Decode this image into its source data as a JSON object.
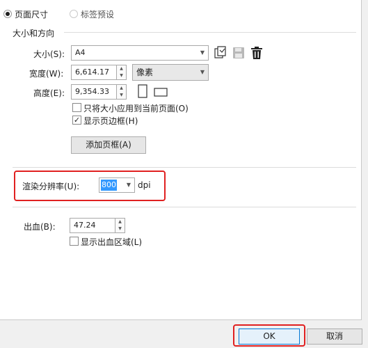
{
  "tabs": {
    "page_size": "页面尺寸",
    "label_preset": "标签预设"
  },
  "section_size": {
    "title": "大小和方向",
    "size_label": "大小(S):",
    "size_value": "A4",
    "width_label": "宽度(W):",
    "width_value": "6,614.17",
    "unit_value": "像素",
    "height_label": "高度(E):",
    "height_value": "9,354.33",
    "apply_current_label": "只将大小应用到当前页面(O)",
    "show_border_label": "显示页边框(H)",
    "add_border_button": "添加页框(A)"
  },
  "icons": {
    "copy": "copy-page-icon",
    "save": "save-icon",
    "delete": "trash-icon",
    "portrait": "portrait-icon",
    "landscape": "landscape-icon"
  },
  "resolution": {
    "label": "渲染分辨率(U):",
    "value": "800",
    "unit": "dpi"
  },
  "bleed": {
    "label": "出血(B):",
    "value": "47.24",
    "show_area_label": "显示出血区域(L)"
  },
  "footer": {
    "ok": "OK",
    "cancel": "取消"
  },
  "colors": {
    "highlight": "#e02020",
    "selection": "#3399ff"
  }
}
